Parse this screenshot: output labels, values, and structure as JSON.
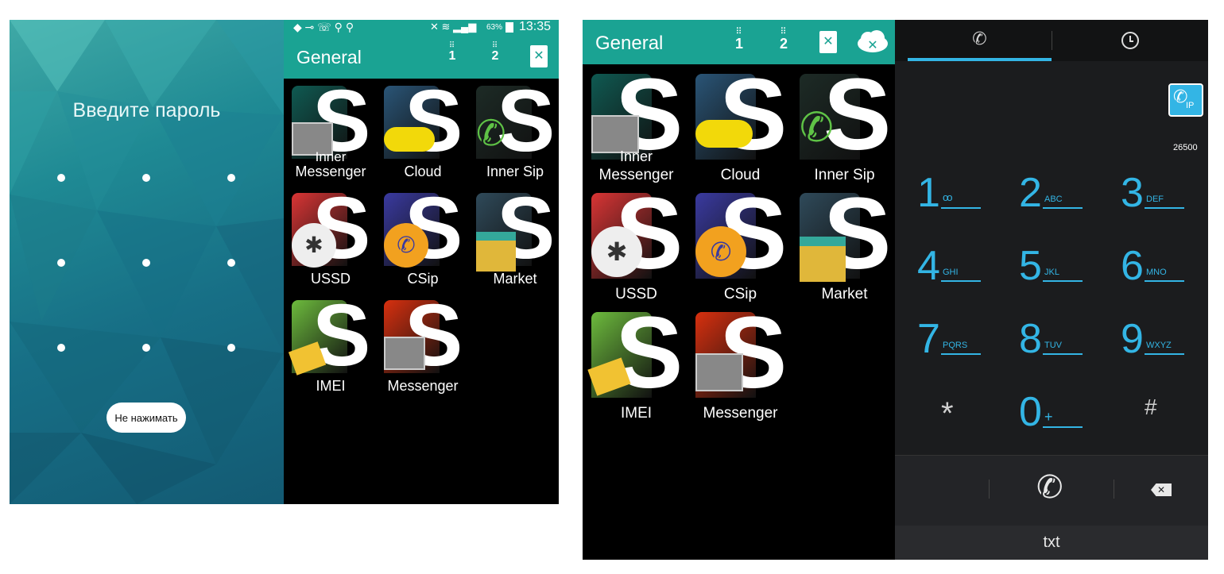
{
  "lock": {
    "title": "Введите пароль",
    "button_label": "Не нажимать"
  },
  "phone_status": {
    "battery": "63%",
    "time": "13:35"
  },
  "launcher": {
    "title": "General",
    "tool1_label": "1",
    "tool2_label": "2",
    "apps": [
      {
        "label_line1": "Inner",
        "label_line2": "Messenger",
        "color": "#0f5a52"
      },
      {
        "label_line1": "",
        "label_line2": "Cloud",
        "color": "#2a5577"
      },
      {
        "label_line1": "",
        "label_line2": "Inner Sip",
        "color": "#1d2b26"
      },
      {
        "label_line1": "",
        "label_line2": "USSD",
        "color": "#d93535"
      },
      {
        "label_line1": "",
        "label_line2": "CSip",
        "color": "#3a3aa0"
      },
      {
        "label_line1": "",
        "label_line2": "Market",
        "color": "#2f4a5a"
      },
      {
        "label_line1": "",
        "label_line2": "IMEI",
        "color": "#6dbb3d"
      },
      {
        "label_line1": "",
        "label_line2": "Messenger",
        "color": "#d8300f"
      }
    ],
    "big_letter": "S"
  },
  "dialer": {
    "ip_badge": "IP",
    "counter": "26500",
    "keys": [
      {
        "num": "1",
        "letters": "oo"
      },
      {
        "num": "2",
        "letters": "ABC"
      },
      {
        "num": "3",
        "letters": "DEF"
      },
      {
        "num": "4",
        "letters": "GHI"
      },
      {
        "num": "5",
        "letters": "JKL"
      },
      {
        "num": "6",
        "letters": "MNO"
      },
      {
        "num": "7",
        "letters": "PQRS"
      },
      {
        "num": "8",
        "letters": "TUV"
      },
      {
        "num": "9",
        "letters": "WXYZ"
      },
      {
        "num": "*",
        "letters": ""
      },
      {
        "num": "0",
        "letters": "+"
      },
      {
        "num": "#",
        "letters": ""
      }
    ],
    "bottom_label": "txt"
  },
  "colors": {
    "teal_bar": "#1aa393",
    "dial_blue": "#33b5e5"
  }
}
